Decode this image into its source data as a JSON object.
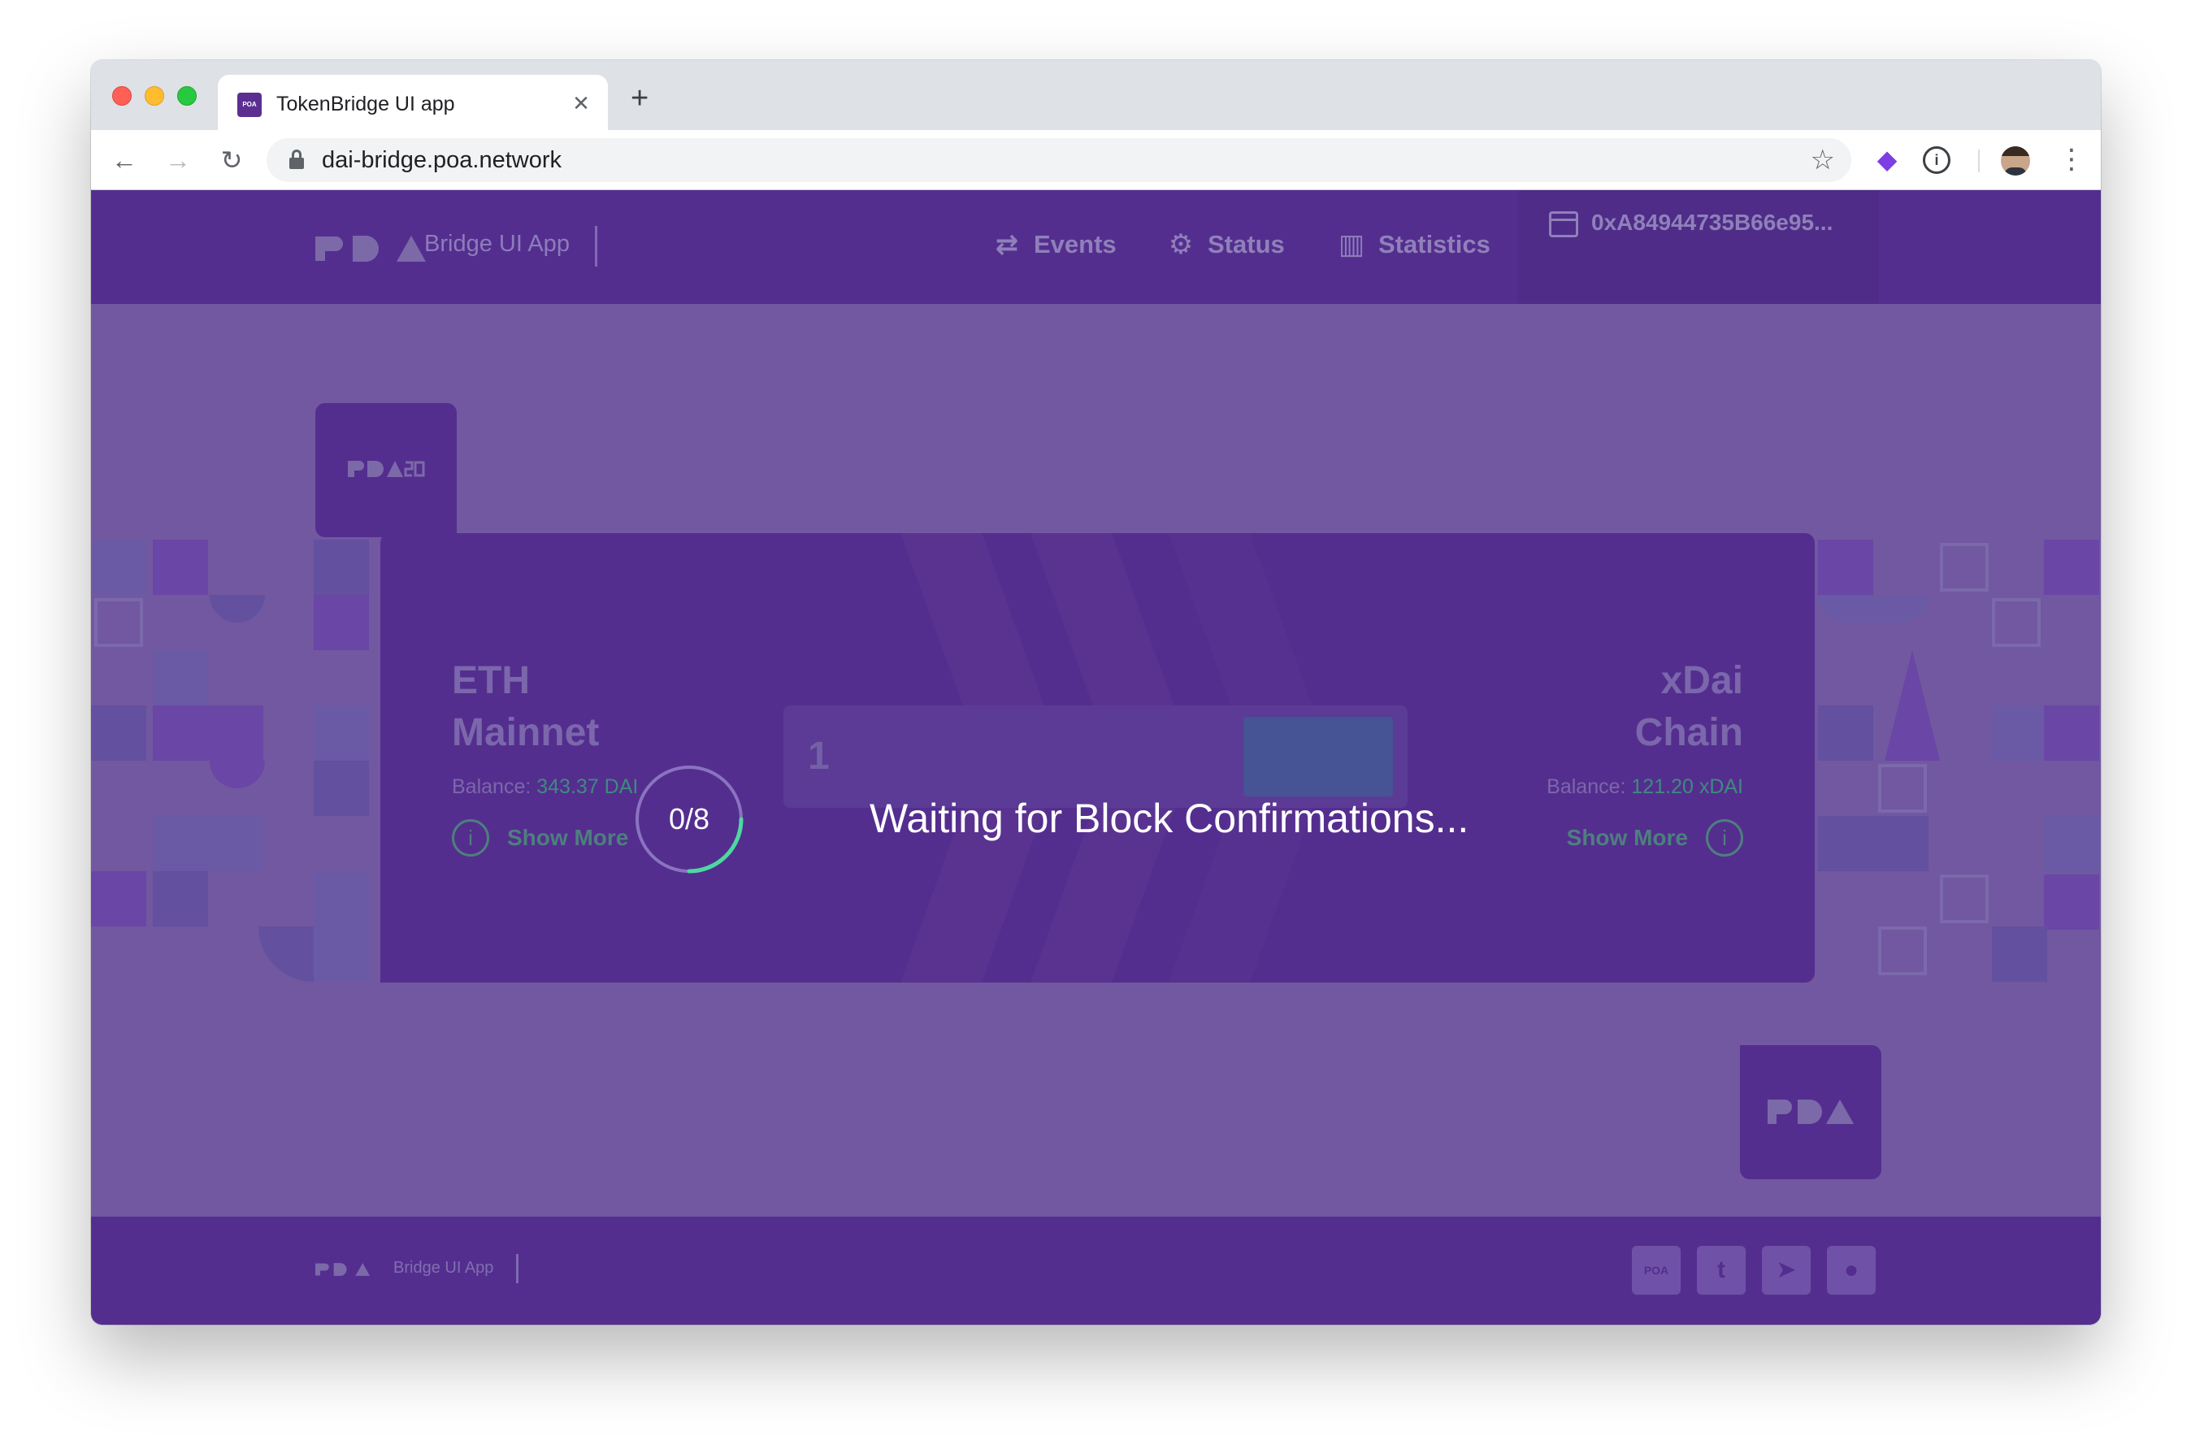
{
  "browser": {
    "tab_title": "TokenBridge UI app",
    "tab_favicon_text": "POA",
    "tab_close": "✕",
    "new_tab": "+",
    "back": "←",
    "forward": "→",
    "reload": "↻",
    "url": "dai-bridge.poa.network",
    "bookmark_icon": "☆",
    "extension_icon": "◆",
    "onepassword_icon": "i",
    "menu_icon": "⋮"
  },
  "header": {
    "logo_label": "Bridge UI App",
    "nav": [
      {
        "label": "Events",
        "icon": "⇄"
      },
      {
        "label": "Status",
        "icon": "⚙"
      },
      {
        "label": "Statistics",
        "icon": "▥"
      }
    ],
    "wallet_address": "0xA84944735B66e95..."
  },
  "bridge": {
    "left_tab_logo": "POA20",
    "right_tab_logo": "POA",
    "eth": {
      "title_line1": "ETH",
      "title_line2": "Mainnet",
      "balance_label": "Balance:",
      "balance_value": "343.37 DAI",
      "show_more": "Show More",
      "info_icon": "i"
    },
    "xdai": {
      "title_line1": "xDai",
      "title_line2": "Chain",
      "balance_label": "Balance:",
      "balance_value": "121.20 xDAI",
      "show_more": "Show More",
      "info_icon": "i"
    },
    "amount_value": "1"
  },
  "loading": {
    "confirmations_text": "0/8",
    "confirmations_done": 0,
    "confirmations_required": 8,
    "message": "Waiting for Block Confirmations..."
  },
  "footer": {
    "logo_label": "Bridge UI App",
    "social": [
      {
        "name": "poa",
        "glyph": "POA"
      },
      {
        "name": "twitter",
        "glyph": "t"
      },
      {
        "name": "telegram",
        "glyph": "➤"
      },
      {
        "name": "github",
        "glyph": "●"
      }
    ]
  },
  "colors": {
    "page_bg": "#7158a0",
    "header_bg": "#542e8f",
    "accent_green": "#4cd9a0"
  }
}
